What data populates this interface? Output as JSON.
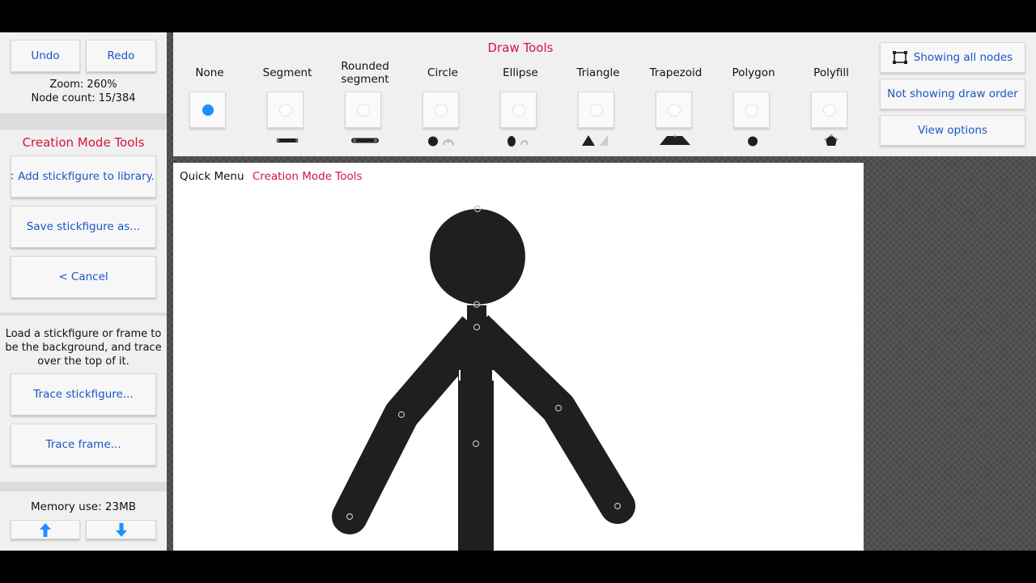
{
  "left_panel": {
    "undo_label": "Undo",
    "redo_label": "Redo",
    "zoom_text": "Zoom: 260%",
    "node_count_text": "Node count: 15/384",
    "creation_title": "Creation Mode Tools",
    "add_to_library_label": "< Add stickfigure to library...",
    "save_as_label": "Save stickfigure as...",
    "cancel_label": "< Cancel",
    "trace_help": "Load a stickfigure or frame to be the background, and trace over the top of it.",
    "trace_stickfigure_label": "Trace stickfigure...",
    "trace_frame_label": "Trace frame...",
    "memory_text": "Memory use: 23MB",
    "arrow_up_icon": "arrow-up-icon",
    "arrow_down_icon": "arrow-down-icon",
    "arrow_color": "#1e90ff"
  },
  "draw_tools": {
    "title": "Draw Tools",
    "selected": "None",
    "tools": [
      {
        "label": "None",
        "selected": true
      },
      {
        "label": "Segment",
        "selected": false
      },
      {
        "label": "Rounded segment",
        "selected": false
      },
      {
        "label": "Circle",
        "selected": false
      },
      {
        "label": "Ellipse",
        "selected": false
      },
      {
        "label": "Triangle",
        "selected": false
      },
      {
        "label": "Trapezoid",
        "selected": false
      },
      {
        "label": "Polygon",
        "selected": false
      },
      {
        "label": "Polyfill",
        "selected": false
      }
    ]
  },
  "view_buttons": {
    "show_nodes_label": "Showing all nodes",
    "draw_order_label": "Not showing draw order",
    "view_options_label": "View options",
    "nodes_icon": "select-box-icon"
  },
  "canvas": {
    "quick_menu_label": "Quick Menu",
    "creation_tools_link": "Creation Mode Tools"
  },
  "colors": {
    "accent_red": "#d4143c",
    "link_blue": "#1a56c4",
    "figure": "#1f1f1f",
    "selected_radio": "#1e90ff"
  }
}
